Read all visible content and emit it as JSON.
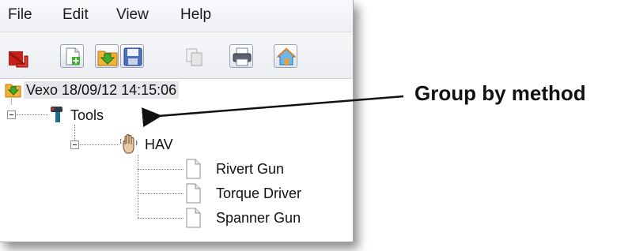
{
  "menubar": {
    "items": [
      "File",
      "Edit",
      "View",
      "Help"
    ]
  },
  "toolbar": {
    "buttons": [
      {
        "icon": "exit-arrow-icon"
      },
      {
        "icon": "new-document-icon"
      },
      {
        "icon": "import-icon"
      },
      {
        "icon": "save-disk-icon"
      },
      {
        "icon": "copy-icon"
      },
      {
        "icon": "printer-icon"
      },
      {
        "icon": "home-icon"
      }
    ]
  },
  "tree": {
    "root": {
      "label": "Vexo 18/09/12 14:15:06",
      "icon": "folder-download-icon"
    },
    "group": {
      "label": "Tools",
      "icon": "drill-icon"
    },
    "method": {
      "label": "HAV",
      "icon": "hand-vibration-icon"
    },
    "items": [
      {
        "label": "Rivert Gun",
        "icon": "document-icon"
      },
      {
        "label": "Torque Driver",
        "icon": "document-icon"
      },
      {
        "label": "Spanner Gun",
        "icon": "document-icon"
      }
    ]
  },
  "annotation": {
    "text": "Group by method"
  },
  "colors": {
    "accent_green": "#3fae2a",
    "accent_orange": "#f0a020",
    "exit_red": "#d7261e",
    "selection_bg": "#e4e6ea"
  }
}
